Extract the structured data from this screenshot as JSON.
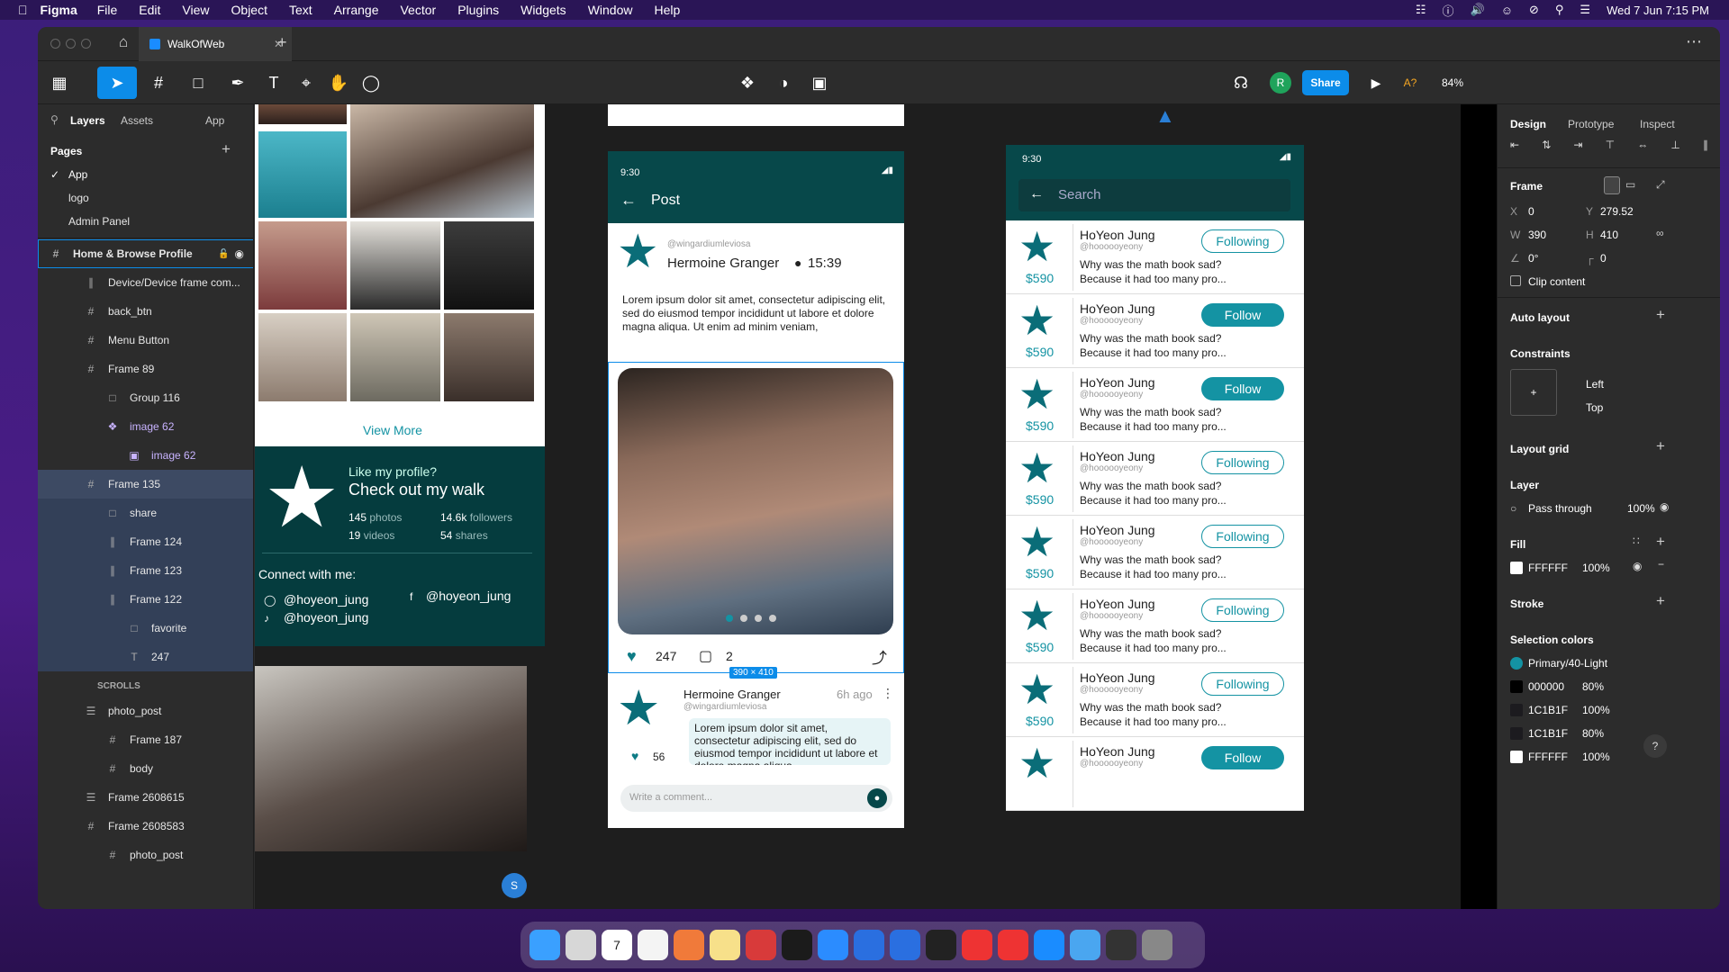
{
  "menubar": {
    "app": "Figma",
    "items": [
      "File",
      "Edit",
      "View",
      "Object",
      "Text",
      "Arrange",
      "Vector",
      "Plugins",
      "Widgets",
      "Window",
      "Help"
    ],
    "clock": "Wed 7 Jun  7:15 PM"
  },
  "tabs": {
    "file_tab": "WalkOfWeb"
  },
  "toolbar": {
    "share": "Share",
    "zoom": "84%",
    "avatar": "R",
    "ai": "A?"
  },
  "left": {
    "tab_layers": "Layers",
    "tab_assets": "Assets",
    "page_switch": "App",
    "pages_header": "Pages",
    "pages": [
      "App",
      "logo",
      "Admin Panel"
    ],
    "layers": [
      "Home & Browse Profile",
      "Device/Device frame com...",
      "back_btn",
      "Menu Button",
      "Frame 89",
      "Group 116",
      "image 62",
      "image 62",
      "Frame 135",
      "share",
      "Frame 124",
      "Frame 123",
      "Frame 122",
      "favorite",
      "247",
      "SCROLLS",
      "photo_post",
      "Frame 187",
      "body",
      "Frame 2608615",
      "Frame 2608583",
      "photo_post"
    ]
  },
  "right": {
    "tabs": [
      "Design",
      "Prototype",
      "Inspect"
    ],
    "frame": "Frame",
    "x_label": "X",
    "x": "0",
    "y_label": "Y",
    "y": "279.52",
    "w_label": "W",
    "w": "390",
    "h_label": "H",
    "h": "410",
    "rot": "0°",
    "radius": "0",
    "clip": "Clip content",
    "auto_layout": "Auto layout",
    "constraints": "Constraints",
    "c_h": "Left",
    "c_v": "Top",
    "layout_grid": "Layout grid",
    "layer": "Layer",
    "blend": "Pass through",
    "opacity": "100%",
    "fill": "Fill",
    "fill_hex": "FFFFFF",
    "fill_op": "100%",
    "stroke": "Stroke",
    "sel_colors": "Selection colors",
    "colors": [
      {
        "name": "Primary/40-Light",
        "op": "",
        "hex": "#1493a3"
      },
      {
        "name": "000000",
        "op": "80%",
        "hex": "#000000"
      },
      {
        "name": "1C1B1F",
        "op": "100%",
        "hex": "#1c1b1f"
      },
      {
        "name": "1C1B1F",
        "op": "80%",
        "hex": "#1c1b1f"
      },
      {
        "name": "FFFFFF",
        "op": "100%",
        "hex": "#ffffff"
      }
    ],
    "help": "?"
  },
  "profile": {
    "view_more": "View More",
    "like": "Like my profile?",
    "walk": "Check out my walk",
    "photos": "145",
    "photos_l": "photos",
    "followers": "14.6k",
    "followers_l": "followers",
    "videos": "19",
    "videos_l": "videos",
    "shares": "54",
    "shares_l": "shares",
    "connect": "Connect with me:",
    "handle1": "@hoyeon_jung",
    "handle2": "@hoyeon_jung",
    "handle3": "@hoyeon_jung",
    "cursor": "S"
  },
  "post": {
    "time": "9:30",
    "title": "Post",
    "user_handle": "@wingardiumleviosa",
    "user": "Hermoine Granger",
    "posted": "15:39",
    "text": "Lorem ipsum dolor sit amet, consectetur adipiscing elit, sed do eiusmod tempor incididunt ut labore et dolore magna aliqua. Ut enim ad minim veniam,",
    "likes": "247",
    "comments": "2",
    "size_badge": "390 × 410",
    "c_user": "Hermoine Granger",
    "c_handle": "@wingardiumleviosa",
    "c_time": "6h ago",
    "c_text": "Lorem ipsum dolor sit amet, consectetur adipiscing elit, sed do eiusmod tempor incididunt ut labore et dolore magna aliqua.",
    "c_likes": "56",
    "write": "Write a comment..."
  },
  "search": {
    "time": "9:30",
    "placeholder": "Search",
    "rows": [
      {
        "name": "HoYeon Jung",
        "handle": "@hoooooyeony",
        "price": "$590",
        "btn": "Following",
        "line1": "Why was the math book sad?",
        "line2": "Because it had too many pro..."
      },
      {
        "name": "HoYeon Jung",
        "handle": "@hoooooyeony",
        "price": "$590",
        "btn": "Follow",
        "line1": "Why was the math book sad?",
        "line2": "Because it had too many pro..."
      },
      {
        "name": "HoYeon Jung",
        "handle": "@hoooooyeony",
        "price": "$590",
        "btn": "Follow",
        "line1": "Why was the math book sad?",
        "line2": "Because it had too many pro..."
      },
      {
        "name": "HoYeon Jung",
        "handle": "@hoooooyeony",
        "price": "$590",
        "btn": "Following",
        "line1": "Why was the math book sad?",
        "line2": "Because it had too many pro..."
      },
      {
        "name": "HoYeon Jung",
        "handle": "@hoooooyeony",
        "price": "$590",
        "btn": "Following",
        "line1": "Why was the math book sad?",
        "line2": "Because it had too many pro..."
      },
      {
        "name": "HoYeon Jung",
        "handle": "@hoooooyeony",
        "price": "$590",
        "btn": "Following",
        "line1": "Why was the math book sad?",
        "line2": "Because it had too many pro..."
      },
      {
        "name": "HoYeon Jung",
        "handle": "@hoooooyeony",
        "price": "$590",
        "btn": "Following",
        "line1": "Why was the math book sad?",
        "line2": "Because it had too many pro..."
      },
      {
        "name": "HoYeon Jung",
        "handle": "@hoooooyeony",
        "price": "",
        "btn": "Follow",
        "line1": "",
        "line2": ""
      }
    ]
  },
  "dock_date": "7"
}
